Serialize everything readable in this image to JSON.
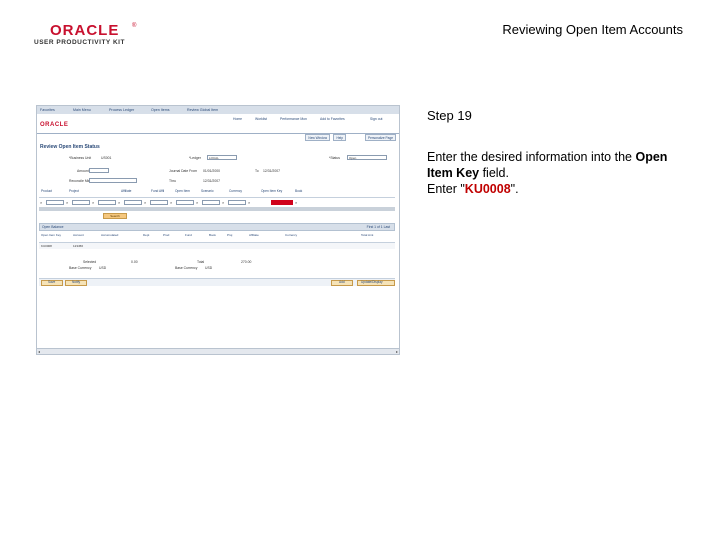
{
  "header": {
    "logo_text": "ORACLE",
    "logo_sub": "USER PRODUCTIVITY KIT",
    "title": "Reviewing Open Item Accounts"
  },
  "instructions": {
    "step": "Step 19",
    "line1_pre": "Enter the desired information into the ",
    "field_name": "Open Item Key",
    "line1_post": " field.",
    "enter_pre": "Enter \"",
    "value": "KU0008",
    "enter_post": "\"."
  },
  "screenshot": {
    "menu": [
      "Favorites",
      "Main Menu",
      "Process Ledger",
      "Open Items",
      "Review Global Item"
    ],
    "brand": "ORACLE",
    "nav": [
      "Home",
      "Worklist",
      "Performance Mon",
      "Add to Favorites",
      "Sign out"
    ],
    "subtabs": [
      "New Window",
      "Help",
      "Personalize Page"
    ],
    "page_title": "Review Open Item Status",
    "fields": {
      "business_unit_label": "*Business Unit",
      "business_unit_value": "US001",
      "ledger_label": "*Ledger",
      "ledger_value": "LOCAL",
      "status_label": "*Status",
      "status_value": "Open",
      "amount_label": "Amount",
      "journal_from_label": "Journal Date From",
      "journal_from_value": "01/01/2000",
      "to_label": "To",
      "to_value": "12/31/2007",
      "reconcile_label": "Reconcile Min",
      "thru_label": "Thru",
      "thru_value": "12/31/2007"
    },
    "grid_headers": [
      "Product",
      "Project",
      "Affiliate",
      "Fund Affil",
      "Open Item",
      "Scenario",
      "Currency",
      "Open Item Key",
      "Book"
    ],
    "search_button": "Search",
    "oe_bar_title": "Open Balance",
    "oe_bar_right": "First 1 of 1 Last",
    "oe_headers": [
      "Open Item Key",
      "Account",
      "Accumulated",
      "Dept",
      "Prod",
      "Fund",
      "Book",
      "Proj",
      "Affiliate",
      "Currency",
      "Total Amt"
    ],
    "oe_row": [
      "KU0008",
      "123456"
    ],
    "totals": {
      "selected_label": "Selected",
      "selected_value": "0.00",
      "total_label": "Total",
      "total_value": "270.00",
      "base_currency_label": "Base Currency",
      "base_currency_value": "USD"
    },
    "footer": [
      "Save",
      "Notify",
      "Add",
      "Update/Display"
    ]
  }
}
